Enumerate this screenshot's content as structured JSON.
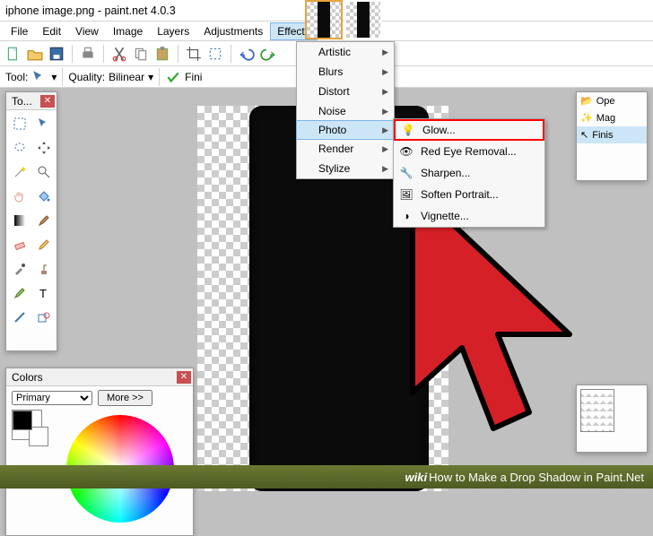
{
  "title": "iphone image.png - paint.net 4.0.3",
  "menu": [
    "File",
    "Edit",
    "View",
    "Image",
    "Layers",
    "Adjustments",
    "Effects"
  ],
  "toolrow": {
    "label_tool": "Tool:",
    "label_quality": "Quality:",
    "quality_val": "Bilinear",
    "fini": "Fini"
  },
  "tools_panel": {
    "title": "To..."
  },
  "colors_panel": {
    "title": "Colors",
    "mode": "Primary",
    "more": "More >>"
  },
  "history_panel": {
    "items": [
      "Ope",
      "Mag",
      "Finis"
    ]
  },
  "thumbs": 2,
  "effects": [
    "Artistic",
    "Blurs",
    "Distort",
    "Noise",
    "Photo",
    "Render",
    "Stylize"
  ],
  "photo_sub": [
    "Glow...",
    "Red Eye Removal...",
    "Sharpen...",
    "Soften Portrait...",
    "Vignette..."
  ],
  "footer": {
    "brand": "wiki",
    "how": "How to Make a Drop Shadow in Paint.Net"
  }
}
